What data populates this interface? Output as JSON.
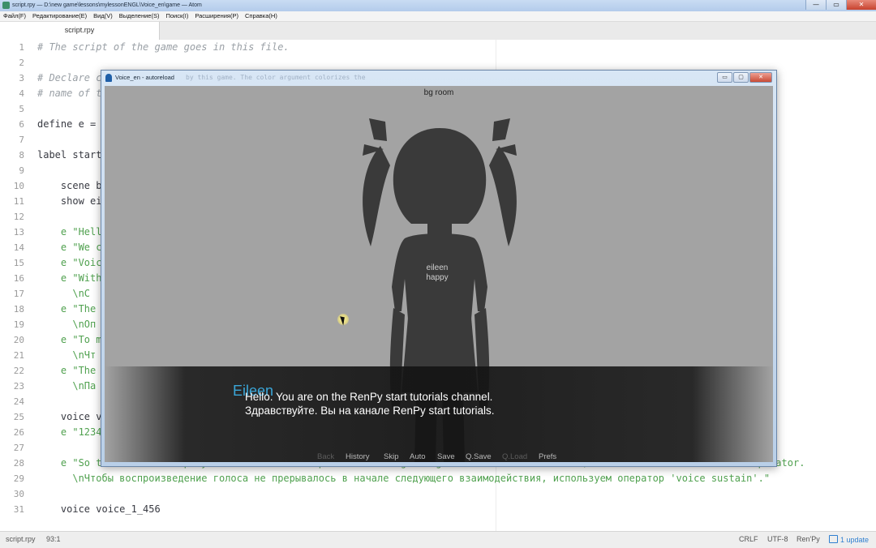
{
  "window": {
    "title": "script.rpy — D:\\new game\\lessons\\mylessonENGL\\Voice_en\\game — Atom",
    "buttons": [
      "—",
      "▭",
      "✕"
    ]
  },
  "menubar": {
    "items": [
      "Файл(F)",
      "Редактирование(E)",
      "Вид(V)",
      "Выделение(S)",
      "Поиск(I)",
      "Расширения(P)",
      "Справка(H)"
    ]
  },
  "tabs": [
    {
      "label": "script.rpy"
    }
  ],
  "editor": {
    "line_numbers": [
      "1",
      "2",
      "3",
      "4",
      "5",
      "6",
      "7",
      "8",
      "9",
      "10",
      "11",
      "12",
      "13",
      "14",
      "15",
      "16",
      "17",
      "18",
      "19",
      "20",
      "21",
      "22",
      "23",
      "24",
      "25",
      "26",
      "27",
      "28",
      "29",
      "30",
      "31"
    ],
    "lines": {
      "l1": "# The script of the game goes in this file.",
      "l3": "# Declare c",
      "l4": "# name of t",
      "l6": "define e = ",
      "l8": "label start",
      "l10": "    scene b",
      "l11": "    show ei",
      "l13": "    e \"Hell",
      "l14": "    e \"We c",
      "l15": "    e \"Voic",
      "l16": "    e \"With",
      "l17": "      \\nС ",
      "l18": "    e \"The ",
      "l19": "      \\nОп",
      "l20": "    e \"To m",
      "l21": "      \\nЧт",
      "l22": "    e \"The ",
      "l23": "      \\nПа",
      "l25": "    voice v",
      "l26": "    e \"1234",
      "l28": "    e \"So that the voice playback is not interrupted at the beginning of the next interaction, we use the 'voice sustain' operator.",
      "l29": "      \\nЧтобы воспроизведение голоса не прерывалось в начале следующего взаимодействия, используем оператор 'voice sustain'.\"",
      "l31": "    voice voice_1_456"
    }
  },
  "statusbar": {
    "file": "script.rpy",
    "cursor": "93:1",
    "line_ending": "CRLF",
    "encoding": "UTF-8",
    "grammar": "Ren'Py",
    "updates": "1 update"
  },
  "game_window": {
    "title": "Voice_en - autoreload",
    "faded_text": "by this game. The color argument colorizes the",
    "buttons": [
      "▭",
      "▢",
      "✕"
    ],
    "bg_label": "bg room",
    "sprite_label_1": "eileen",
    "sprite_label_2": "happy",
    "speaker": "Eileen",
    "dialogue_line_1": "Hello. You are on the RenPy start tutorials channel.",
    "dialogue_line_2": "Здравствуйте. Вы на канале RenPy start tutorials.",
    "quick_menu": {
      "back": "Back",
      "history": "History",
      "skip": "Skip",
      "auto": "Auto",
      "save": "Save",
      "qsave": "Q.Save",
      "qload": "Q.Load",
      "prefs": "Prefs"
    }
  },
  "colors": {
    "speaker": "#3aa6d8",
    "string": "#50a14f",
    "comment": "#9aa0a6",
    "game_bg": "#a3a3a3"
  }
}
